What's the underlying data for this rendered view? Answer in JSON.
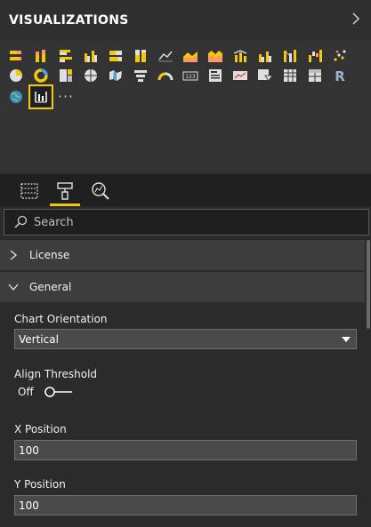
{
  "header": {
    "title": "VISUALIZATIONS"
  },
  "gallery": {
    "row1": [
      "stacked-bar-chart-icon",
      "stacked-column-chart-icon",
      "clustered-bar-chart-icon",
      "clustered-column-chart-icon",
      "100-percent-bar-chart-icon",
      "100-percent-column-chart-icon",
      "line-chart-icon",
      "area-chart-icon",
      "stacked-area-chart-icon",
      "line-and-column-chart-icon",
      "line-and-clustered-column-chart-icon",
      "ribbon-chart-icon",
      "waterfall-chart-icon",
      "scatter-chart-icon"
    ],
    "row2": [
      "pie-chart-icon",
      "donut-chart-icon",
      "treemap-icon",
      "map-icon",
      "filled-map-icon",
      "funnel-icon",
      "gauge-icon",
      "card-icon",
      "multi-row-card-icon",
      "kpi-icon",
      "slicer-icon",
      "table-icon",
      "matrix-icon",
      "r-script-icon"
    ],
    "row3": [
      "globe-map-icon",
      "custom-visual-icon",
      "more-icon"
    ],
    "more_label": "···",
    "r_label": "R",
    "accent": "#f2c80f"
  },
  "tabs": [
    "fields-tab",
    "format-tab",
    "analytics-tab"
  ],
  "search": {
    "placeholder": "Search"
  },
  "sections": {
    "license": "License",
    "general": "General"
  },
  "general": {
    "orientation_label": "Chart Orientation",
    "orientation_value": "Vertical",
    "align_label": "Align Threshold",
    "align_value": "Off",
    "x_label": "X Position",
    "x_value": "100",
    "y_label": "Y Position",
    "y_value": "100"
  }
}
